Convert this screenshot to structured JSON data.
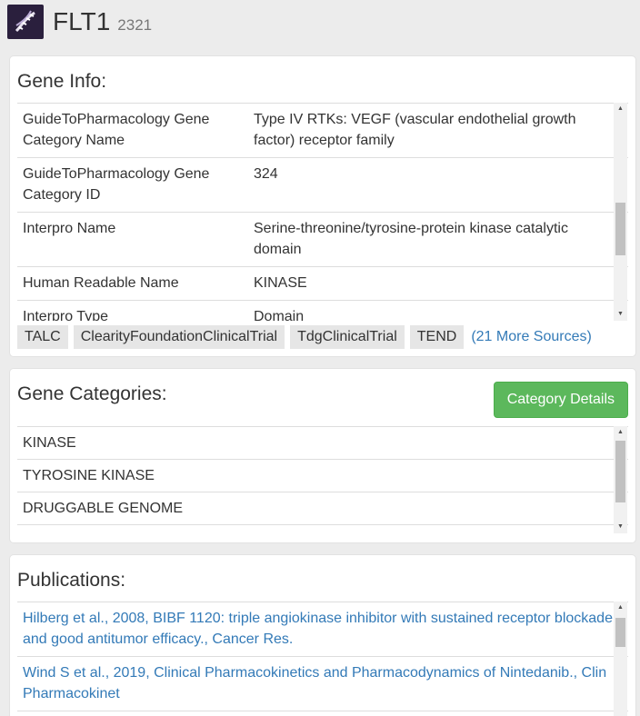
{
  "header": {
    "title": "FLT1",
    "gene_id": "2321",
    "logo_icon": "dna-icon"
  },
  "gene_info": {
    "title": "Gene Info:",
    "rows": [
      {
        "key": "GuideToPharmacology Gene Category Name",
        "value": "Type IV RTKs: VEGF (vascular endothelial growth factor) receptor family"
      },
      {
        "key": "GuideToPharmacology Gene Category ID",
        "value": "324"
      },
      {
        "key": "Interpro Name",
        "value": "Serine-threonine/tyrosine-protein kinase catalytic domain"
      },
      {
        "key": "Human Readable Name",
        "value": "KINASE"
      },
      {
        "key": "Interpro Type",
        "value": "Domain"
      }
    ],
    "sources": [
      "TALC",
      "ClearityFoundationClinicalTrial",
      "TdgClinicalTrial",
      "TEND"
    ],
    "more_sources": "(21 More Sources)"
  },
  "gene_categories": {
    "title": "Gene Categories:",
    "button_label": "Category Details",
    "items": [
      "KINASE",
      "TYROSINE KINASE",
      "DRUGGABLE GENOME"
    ]
  },
  "publications": {
    "title": "Publications:",
    "items": [
      "Hilberg et al., 2008, BIBF 1120: triple angiokinase inhibitor with sustained receptor blockade and good antitumor efficacy., Cancer Res.",
      "Wind S et al., 2019, Clinical Pharmacokinetics and Pharmacodynamics of Nintedanib., Clin Pharmacokinet"
    ]
  },
  "colors": {
    "accent_link": "#337ab7",
    "button_green": "#5cb85c",
    "page_bg": "#ececec"
  }
}
